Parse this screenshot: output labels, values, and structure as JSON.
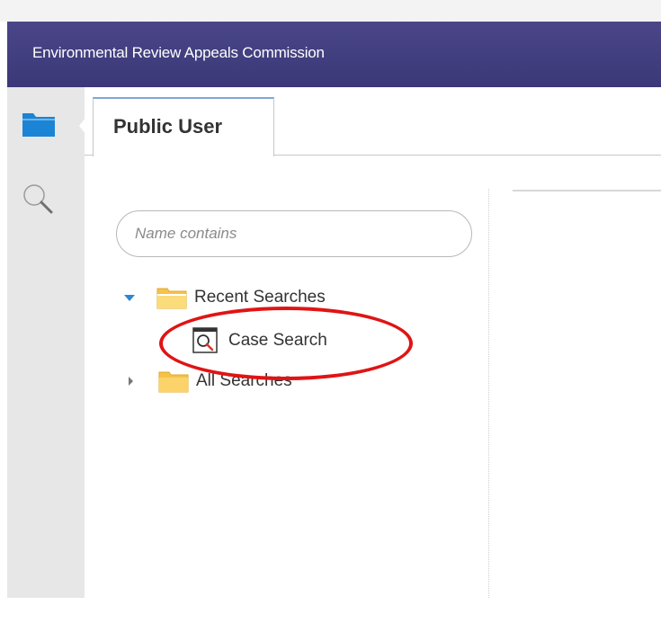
{
  "header": {
    "title": "Environmental Review Appeals Commission"
  },
  "left_rail": {
    "items": [
      {
        "icon": "folder-icon",
        "active": true
      },
      {
        "icon": "search-icon",
        "active": false
      }
    ]
  },
  "tabs": [
    {
      "label": "Public User",
      "active": true
    }
  ],
  "search": {
    "placeholder": "Name contains",
    "value": ""
  },
  "tree": {
    "recent": {
      "label": "Recent Searches",
      "expanded": true,
      "icon": "folder-open-icon"
    },
    "recent_items": [
      {
        "label": "Case Search",
        "icon": "search-document-icon"
      }
    ],
    "all": {
      "label": "All Searches",
      "expanded": false,
      "icon": "folder-icon"
    }
  },
  "colors": {
    "header": "#3f3c7e",
    "folder_blue": "#1c84d4",
    "folder_yellow": "#f6c247",
    "caret_blue": "#2e86d4",
    "annotation_red": "#e01414"
  }
}
